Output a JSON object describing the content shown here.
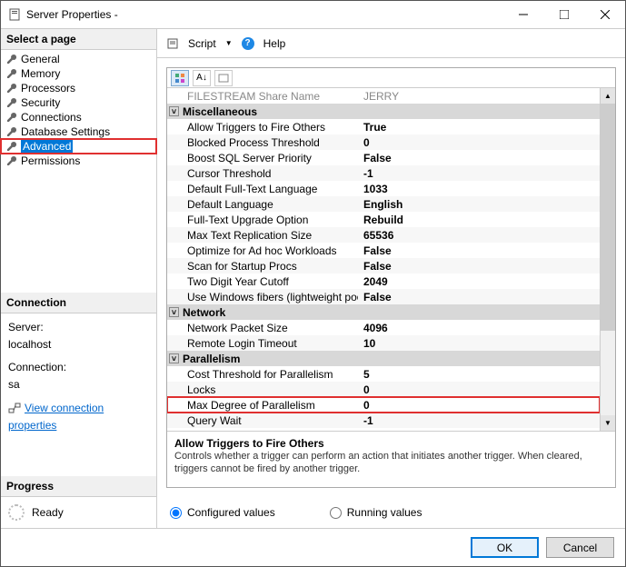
{
  "window": {
    "title": "Server Properties -"
  },
  "left": {
    "select_page": "Select a page",
    "pages": [
      "General",
      "Memory",
      "Processors",
      "Security",
      "Connections",
      "Database Settings",
      "Advanced",
      "Permissions"
    ],
    "selected": "Advanced",
    "connection_header": "Connection",
    "server_label": "Server:",
    "server_value": "localhost",
    "connection_label": "Connection:",
    "connection_value": "sa",
    "view_props": "View connection properties",
    "progress_header": "Progress",
    "progress_status": "Ready"
  },
  "toolbar": {
    "script": "Script",
    "help": "Help"
  },
  "grid": {
    "header_row": {
      "name": "FILESTREAM Share Name",
      "value": "JERRY"
    },
    "groups": [
      {
        "title": "Miscellaneous",
        "rows": [
          {
            "name": "Allow Triggers to Fire Others",
            "value": "True",
            "bold": true
          },
          {
            "name": "Blocked Process Threshold",
            "value": "0",
            "bold": true
          },
          {
            "name": "Boost SQL Server Priority",
            "value": "False",
            "bold": true
          },
          {
            "name": "Cursor Threshold",
            "value": "-1",
            "bold": true
          },
          {
            "name": "Default Full-Text Language",
            "value": "1033",
            "bold": true
          },
          {
            "name": "Default Language",
            "value": "English",
            "bold": true
          },
          {
            "name": "Full-Text Upgrade Option",
            "value": "Rebuild",
            "bold": true
          },
          {
            "name": "Max Text Replication Size",
            "value": "65536",
            "bold": true
          },
          {
            "name": "Optimize for Ad hoc Workloads",
            "value": "False",
            "bold": true
          },
          {
            "name": "Scan for Startup Procs",
            "value": "False",
            "bold": true
          },
          {
            "name": "Two Digit Year Cutoff",
            "value": "2049",
            "bold": true
          },
          {
            "name": "Use Windows fibers (lightweight pooling)",
            "value": "False",
            "bold": true
          }
        ]
      },
      {
        "title": "Network",
        "rows": [
          {
            "name": "Network Packet Size",
            "value": "4096",
            "bold": true
          },
          {
            "name": "Remote Login Timeout",
            "value": "10",
            "bold": true
          }
        ]
      },
      {
        "title": "Parallelism",
        "rows": [
          {
            "name": "Cost Threshold for Parallelism",
            "value": "5",
            "bold": true
          },
          {
            "name": "Locks",
            "value": "0",
            "bold": true
          },
          {
            "name": "Max Degree of Parallelism",
            "value": "0",
            "bold": true,
            "hl": true
          },
          {
            "name": "Query Wait",
            "value": "-1",
            "bold": true
          }
        ]
      }
    ]
  },
  "desc": {
    "title": "Allow Triggers to Fire Others",
    "text": "Controls whether a trigger can perform an action that initiates another trigger. When cleared, triggers cannot be fired by another trigger."
  },
  "radios": {
    "configured": "Configured values",
    "running": "Running values"
  },
  "buttons": {
    "ok": "OK",
    "cancel": "Cancel"
  }
}
